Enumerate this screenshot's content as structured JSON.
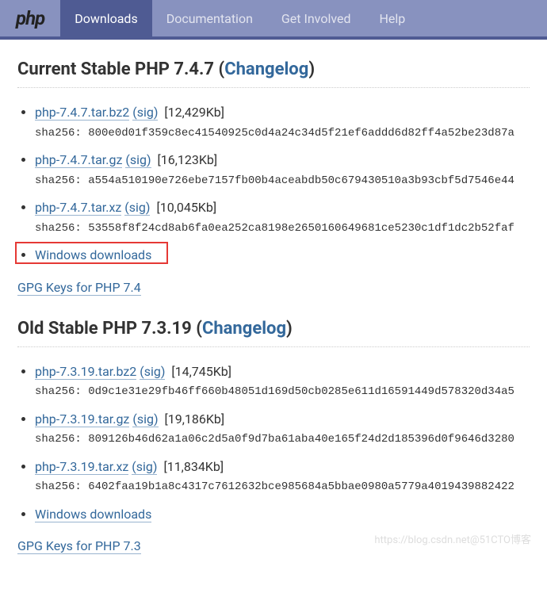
{
  "logo": "php",
  "nav": {
    "items": [
      {
        "label": "Downloads",
        "active": true
      },
      {
        "label": "Documentation",
        "active": false
      },
      {
        "label": "Get Involved",
        "active": false
      },
      {
        "label": "Help",
        "active": false
      }
    ]
  },
  "sections": [
    {
      "title_prefix": "Current Stable PHP 7.4.7 (",
      "changelog": "Changelog",
      "title_suffix": ")",
      "files": [
        {
          "name": "php-7.4.7.tar.bz2",
          "sig": "(sig)",
          "size": "[12,429Kb]",
          "sha": "sha256: 800e0d01f359c8ec41540925c0d4a24c34d5f21ef6addd6d82ff4a52be23d87a"
        },
        {
          "name": "php-7.4.7.tar.gz",
          "sig": "(sig)",
          "size": "[16,123Kb]",
          "sha": "sha256: a554a510190e726ebe7157fb00b4aceabdb50c679430510a3b93cbf5d7546e44"
        },
        {
          "name": "php-7.4.7.tar.xz",
          "sig": "(sig)",
          "size": "[10,045Kb]",
          "sha": "sha256: 53558f8f24cd8ab6fa0ea252ca8198e2650160649681ce5230c1df1dc2b52faf"
        }
      ],
      "windows": "Windows downloads",
      "windows_highlight": true,
      "gpg": "GPG Keys for PHP 7.4"
    },
    {
      "title_prefix": "Old Stable PHP 7.3.19 (",
      "changelog": "Changelog",
      "title_suffix": ")",
      "files": [
        {
          "name": "php-7.3.19.tar.bz2",
          "sig": "(sig)",
          "size": "[14,745Kb]",
          "sha": "sha256: 0d9c1e31e29fb46ff660b48051d169d50cb0285e611d16591449d578320d34a5"
        },
        {
          "name": "php-7.3.19.tar.gz",
          "sig": "(sig)",
          "size": "[19,186Kb]",
          "sha": "sha256: 809126b46d62a1a06c2d5a0f9d7ba61aba40e165f24d2d185396d0f9646d3280"
        },
        {
          "name": "php-7.3.19.tar.xz",
          "sig": "(sig)",
          "size": "[11,834Kb]",
          "sha": "sha256: 6402faa19b1a8c4317c7612632bce985684a5bbae0980a5779a4019439882422"
        }
      ],
      "windows": "Windows downloads",
      "windows_highlight": false,
      "gpg": "GPG Keys for PHP 7.3"
    }
  ],
  "watermark": "https://blog.csdn.net@51CTO博客"
}
